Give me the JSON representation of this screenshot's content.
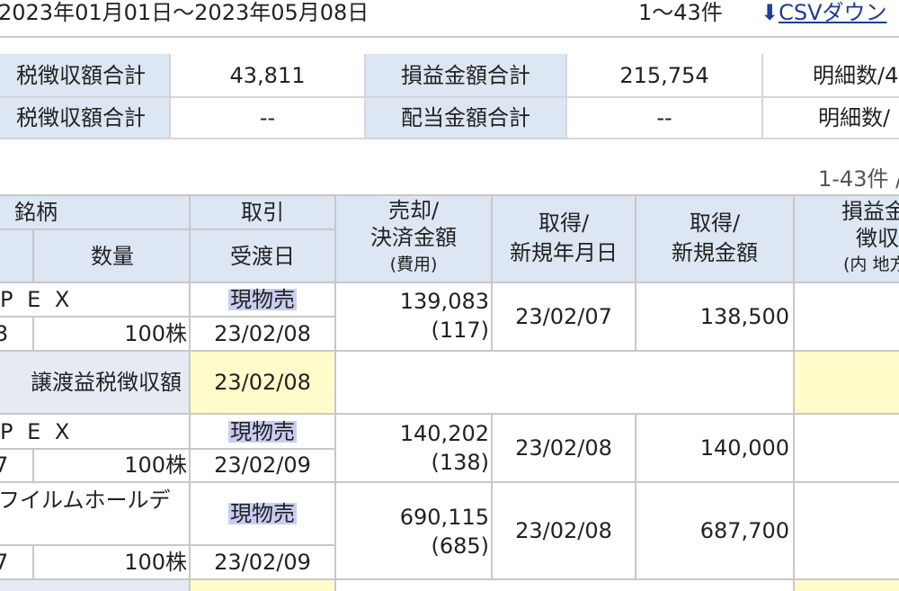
{
  "top": {
    "date_range": "2023年01月01日〜2023年05月08日",
    "count": "1〜43件",
    "csv_label": "CSVダウン"
  },
  "summary": {
    "row1": {
      "label1": "税徴収額合計",
      "value1": "43,811",
      "label2": "損益金額合計",
      "value2": "215,754",
      "label3": "明細数/4"
    },
    "row2": {
      "label1": "税徴収額合計",
      "value1": "--",
      "label2": "配当金額合計",
      "value2": "--",
      "label3": "明細数/"
    }
  },
  "range_label": "1-43件 /",
  "table": {
    "headers": {
      "meigara": "銘柄",
      "torihiki": "取引",
      "suryo": "数量",
      "ukewatashi": "受渡日",
      "baikyaku1": "売却/",
      "baikyaku2": "決済金額",
      "baikyaku3": "(費用)",
      "shutoku_date1": "取得/",
      "shutoku_date2": "新規年月日",
      "shutoku_amt1": "取得/",
      "shutoku_amt2": "新規金額",
      "soneki1": "損益金",
      "soneki2": "徴収",
      "soneki3": "(内 地方"
    },
    "rows": [
      {
        "name": "P E X",
        "code": "3",
        "type": "現物売",
        "qty": "100株",
        "delivery": "23/02/08",
        "amount": "139,083",
        "fee": "(117)",
        "acq_date": "23/02/07",
        "acq_amount": "138,500"
      },
      {
        "name": "P E X",
        "code": "7",
        "type": "現物売",
        "qty": "100株",
        "delivery": "23/02/09",
        "amount": "140,202",
        "fee": "(138)",
        "acq_date": "23/02/08",
        "acq_amount": "140,000"
      },
      {
        "name": "フイルムホールデ",
        "code": "7",
        "type": "現物売",
        "qty": "100株",
        "delivery": "23/02/09",
        "amount": "690,115",
        "fee": "(685)",
        "acq_date": "23/02/08",
        "acq_amount": "687,700"
      }
    ],
    "tax_row": {
      "label": "譲渡益税徴収額",
      "date": "23/02/08"
    }
  }
}
